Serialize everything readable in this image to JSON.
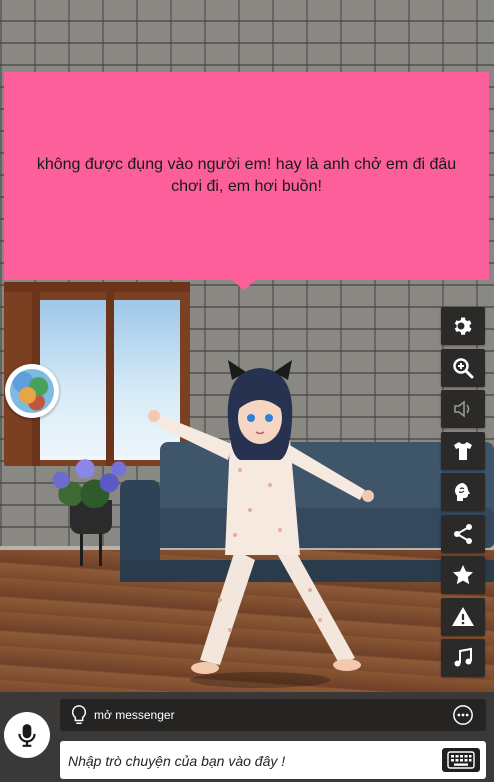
{
  "speech_bubble": {
    "text": "không được đụng vào người em! hay là anh chở em đi đâu chơi đi, em hơi buồn!"
  },
  "toolbar": {
    "buttons": [
      {
        "name": "settings",
        "icon": "gear-icon"
      },
      {
        "name": "zoom",
        "icon": "zoom-in-icon"
      },
      {
        "name": "sound",
        "icon": "speaker-icon"
      },
      {
        "name": "outfit",
        "icon": "shirt-icon"
      },
      {
        "name": "brain",
        "icon": "brain-icon"
      },
      {
        "name": "share",
        "icon": "share-icon"
      },
      {
        "name": "favorite",
        "icon": "star-icon"
      },
      {
        "name": "report",
        "icon": "warning-icon"
      },
      {
        "name": "music",
        "icon": "music-icon"
      }
    ]
  },
  "suggestion": {
    "text": "mở messenger",
    "icon": "lightbulb-icon",
    "more_icon": "more-icon"
  },
  "chat_input": {
    "placeholder": "Nhập trò chuyện của bạn vào đây !",
    "keyboard_icon": "keyboard-icon"
  },
  "colors": {
    "bubble": "#fc5f99",
    "toolbar_button": "#2b2a28",
    "bottom_bar": "#3a3937"
  }
}
